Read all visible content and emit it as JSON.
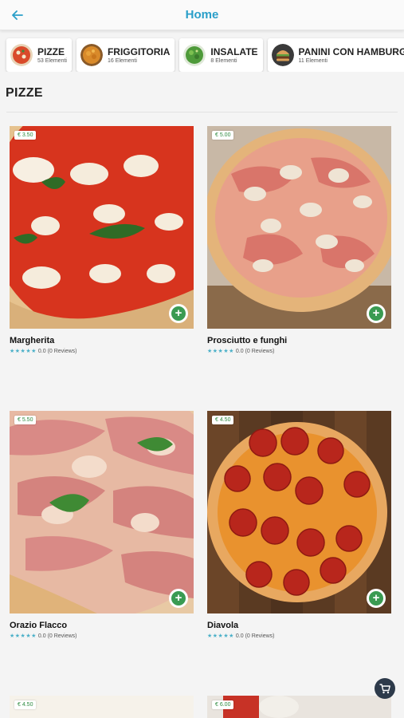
{
  "header": {
    "title": "Home",
    "back_icon": "arrow-left-icon"
  },
  "categories": [
    {
      "name": "PIZZE",
      "count": "53 Elementi"
    },
    {
      "name": "FRIGGITORIA",
      "count": "16 Elementi"
    },
    {
      "name": "INSALATE",
      "count": "8 Elementi"
    },
    {
      "name": "PANINI CON HAMBURGER",
      "count": "11 Elementi"
    }
  ],
  "section_title": "PIZZE",
  "products": [
    {
      "name": "Margherita",
      "price": "€ 3.50",
      "rating": "0.0 (0 Reviews)",
      "stars": "★★★★★"
    },
    {
      "name": "Prosciutto e funghi",
      "price": "€ 5.00",
      "rating": "0.0 (0 Reviews)",
      "stars": "★★★★★"
    },
    {
      "name": "Orazio Flacco",
      "price": "€ 5.50",
      "rating": "0.0 (0 Reviews)",
      "stars": "★★★★★"
    },
    {
      "name": "Diavola",
      "price": "€ 4.50",
      "rating": "0.0 (0 Reviews)",
      "stars": "★★★★★"
    },
    {
      "price": "€ 4.50"
    },
    {
      "price": "€ 6.00"
    }
  ],
  "colors": {
    "accent": "#2a9fc9",
    "add_button": "#3a9b52",
    "price_text": "#2e8b40",
    "cart": "#2d3a4a"
  },
  "cart_icon": "shopping-cart-icon"
}
